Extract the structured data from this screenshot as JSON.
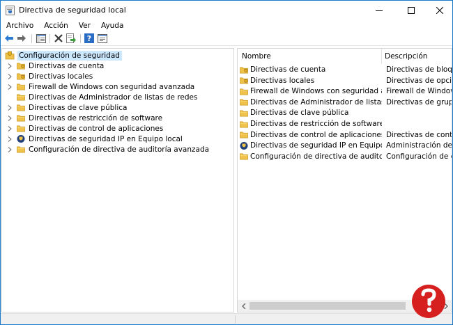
{
  "window": {
    "title": "Directiva de seguridad local",
    "minimize_icon": "minimize-icon",
    "maximize_icon": "maximize-icon",
    "close_icon": "close-icon"
  },
  "menu": [
    "Archivo",
    "Acción",
    "Ver",
    "Ayuda"
  ],
  "toolbar": {
    "buttons": [
      "back-arrow-icon",
      "forward-arrow-icon",
      "show-hide-tree-icon",
      "delete-icon",
      "export-list-icon",
      "help-icon",
      "properties-icon"
    ]
  },
  "tree": {
    "root": "Configuración de seguridad",
    "items": [
      {
        "label": "Directivas de cuenta",
        "icon": "policy-folder-icon",
        "expandable": true
      },
      {
        "label": "Directivas locales",
        "icon": "policy-folder-icon",
        "expandable": true
      },
      {
        "label": "Firewall de Windows con seguridad avanzada",
        "icon": "folder-icon",
        "expandable": true
      },
      {
        "label": "Directivas de Administrador de listas de redes",
        "icon": "folder-icon",
        "expandable": false
      },
      {
        "label": "Directivas de clave pública",
        "icon": "folder-icon",
        "expandable": true
      },
      {
        "label": "Directivas de restricción de software",
        "icon": "folder-icon",
        "expandable": true
      },
      {
        "label": "Directivas de control de aplicaciones",
        "icon": "folder-icon",
        "expandable": true
      },
      {
        "label": "Directivas de seguridad IP en Equipo local",
        "icon": "ipsec-shield-icon",
        "expandable": true
      },
      {
        "label": "Configuración de directiva de auditoría avanzada",
        "icon": "folder-icon",
        "expandable": true
      }
    ]
  },
  "list": {
    "columns": [
      "Nombre",
      "Descripción"
    ],
    "rows": [
      {
        "name": "Directivas de cuenta",
        "desc": "Directivas de bloqueo",
        "icon": "policy-folder-icon"
      },
      {
        "name": "Directivas locales",
        "desc": "Directivas de opciones",
        "icon": "policy-folder-icon"
      },
      {
        "name": "Firewall de Windows con seguridad avanza...",
        "desc": "Firewall de Windows c",
        "icon": "folder-icon"
      },
      {
        "name": "Directivas de Administrador de listas de r...",
        "desc": "Directivas de grupo de",
        "icon": "folder-icon"
      },
      {
        "name": "Directivas de clave pública",
        "desc": "",
        "icon": "folder-icon"
      },
      {
        "name": "Directivas de restricción de software",
        "desc": "",
        "icon": "folder-icon"
      },
      {
        "name": "Directivas de control de aplicaciones",
        "desc": "Directivas de control c",
        "icon": "folder-icon"
      },
      {
        "name": "Directivas de seguridad IP en Equipo local",
        "desc": "Administración del pro",
        "icon": "ipsec-shield-icon"
      },
      {
        "name": "Configuración de directiva de auditoría a...",
        "desc": "Configuración de dire",
        "icon": "folder-icon"
      }
    ]
  },
  "colors": {
    "selection": "#cce8ff",
    "folder": "#f0c24a",
    "border_accent": "#1979ca"
  }
}
